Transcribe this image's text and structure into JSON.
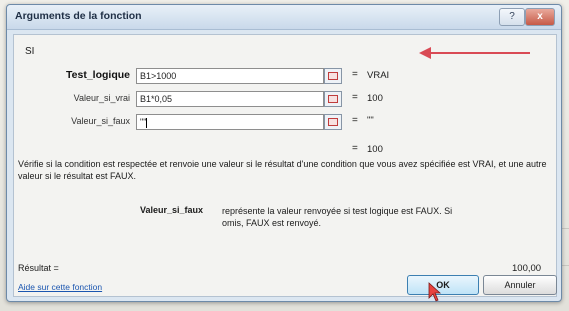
{
  "dialog": {
    "title": "Arguments de la fonction",
    "help_label": "?",
    "close_label": "x"
  },
  "function_name": "SI",
  "args": [
    {
      "label": "Test_logique",
      "value": "B1>1000",
      "result": "VRAI"
    },
    {
      "label": "Valeur_si_vrai",
      "value": "B1*0,05",
      "result": "100"
    },
    {
      "label": "Valeur_si_faux",
      "value": "\"\"",
      "result": "\"\""
    }
  ],
  "function_result_preview": "100",
  "description": "Vérifie si la condition est respectée et renvoie une valeur si le résultat d'une condition que vous avez spécifiée est VRAI, et une autre valeur si le résultat est FAUX.",
  "arg_description": {
    "name": "Valeur_si_faux",
    "text": "représente la valeur renvoyée si test logique est FAUX. Si omis, FAUX est renvoyé."
  },
  "result_label": "Résultat =",
  "result_value": "100,00",
  "help_link": "Aide sur cette fonction",
  "buttons": {
    "ok": "OK",
    "cancel": "Annuler"
  },
  "equals": "=",
  "colors": {
    "accent_arrow": "#d94a55",
    "title_bar": "#c9d9ea",
    "link": "#1b56b0"
  }
}
